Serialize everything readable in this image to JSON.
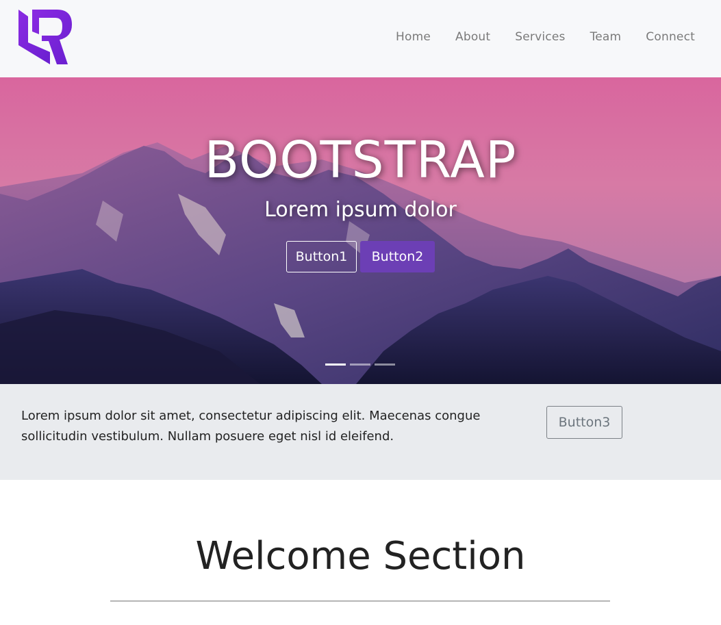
{
  "nav": {
    "items": [
      {
        "label": "Home"
      },
      {
        "label": "About"
      },
      {
        "label": "Services"
      },
      {
        "label": "Team"
      },
      {
        "label": "Connect"
      }
    ]
  },
  "hero": {
    "title": "BOOTSTRAP",
    "subtitle": "Lorem ipsum dolor",
    "button1": "Button1",
    "button2": "Button2",
    "slides": 3,
    "active_slide": 1
  },
  "info": {
    "text": "Lorem ipsum dolor sit amet, consectetur adipiscing elit. Maecenas congue sollicitudin vestibulum. Nullam posuere eget nisl id eleifend.",
    "button3": "Button3"
  },
  "welcome": {
    "title": "Welcome Section"
  },
  "colors": {
    "brand": "#7b2ff7",
    "primary_button": "#6c3fb5",
    "navbar_bg": "#f7f8fa",
    "info_bg": "#e9ebee"
  }
}
